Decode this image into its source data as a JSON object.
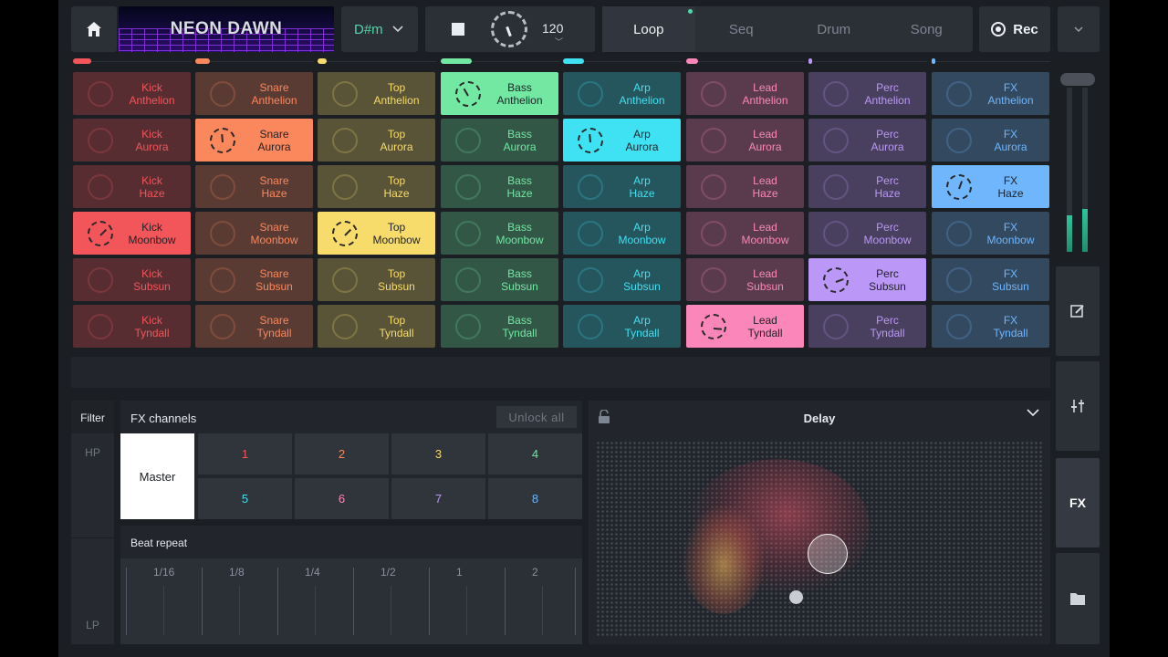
{
  "topbar": {
    "title": "NEON DAWN",
    "key": "D#m",
    "tempo": "120",
    "modes": [
      {
        "label": "Loop",
        "active": true
      },
      {
        "label": "Seq",
        "active": false
      },
      {
        "label": "Drum",
        "active": false
      },
      {
        "label": "Song",
        "active": false
      }
    ],
    "rec_label": "Rec"
  },
  "columns": [
    {
      "name": "Kick",
      "color": "#f2555a",
      "active_row": 3,
      "level": 0.15
    },
    {
      "name": "Snare",
      "color": "#fb875d",
      "active_row": 1,
      "level": 0.12
    },
    {
      "name": "Top",
      "color": "#f7dc6c",
      "active_row": 3,
      "level": 0.08
    },
    {
      "name": "Bass",
      "color": "#72e8a3",
      "active_row": 0,
      "level": 0.26
    },
    {
      "name": "Arp",
      "color": "#3ee2f3",
      "active_row": 1,
      "level": 0.18
    },
    {
      "name": "Lead",
      "color": "#fb86b9",
      "active_row": 5,
      "level": 0.1
    },
    {
      "name": "Perc",
      "color": "#bb97f7",
      "active_row": 4,
      "level": 0.02
    },
    {
      "name": "FX",
      "color": "#6fb6fd",
      "active_row": 2,
      "level": 0.02
    }
  ],
  "rows": [
    "Anthelion",
    "Aurora",
    "Haze",
    "Moonbow",
    "Subsun",
    "Tyndall"
  ],
  "meters": {
    "left": 0.22,
    "right": 0.26
  },
  "side": {
    "fx_label": "FX"
  },
  "filter": {
    "title": "Filter",
    "hp": "HP",
    "lp": "LP"
  },
  "fx_channels": {
    "title": "FX channels",
    "unlock_label": "Unlock all",
    "master_label": "Master",
    "channels": [
      {
        "label": "1",
        "color": "#f2555a"
      },
      {
        "label": "2",
        "color": "#fb875d"
      },
      {
        "label": "3",
        "color": "#f7dc6c"
      },
      {
        "label": "4",
        "color": "#72e8a3"
      },
      {
        "label": "5",
        "color": "#3ee2f3"
      },
      {
        "label": "6",
        "color": "#fb86b9"
      },
      {
        "label": "7",
        "color": "#bb97f7"
      },
      {
        "label": "8",
        "color": "#6fb6fd"
      }
    ]
  },
  "beat_repeat": {
    "title": "Beat repeat",
    "divisions": [
      "1/16",
      "1/8",
      "1/4",
      "1/2",
      "1",
      "2"
    ]
  },
  "xy_pad": {
    "effect": "Delay"
  }
}
